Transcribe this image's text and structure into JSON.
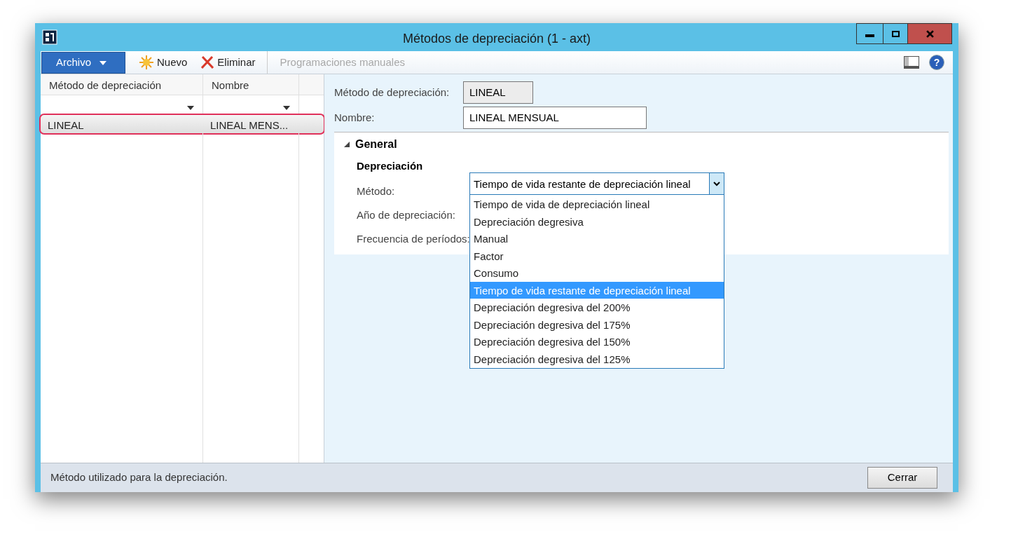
{
  "window": {
    "title": "Métodos de depreciación (1 - axt)"
  },
  "toolbar": {
    "file_menu": "Archivo",
    "buttons": [
      {
        "kind": "new",
        "label": "Nuevo",
        "disabled": false
      },
      {
        "kind": "delete",
        "label": "Eliminar",
        "disabled": false
      },
      {
        "kind": "plain",
        "label": "Programaciones manuales",
        "disabled": true
      }
    ]
  },
  "grid": {
    "columns": [
      "Método de depreciación",
      "Nombre"
    ],
    "rows": [
      {
        "cells": [
          "LINEAL",
          "LINEAL MENS..."
        ],
        "selected": true,
        "highlighted": true
      }
    ]
  },
  "header_fields": [
    {
      "label": "Método de depreciación:",
      "value": "LINEAL",
      "disabled": true
    },
    {
      "label": "Nombre:",
      "value": "LINEAL MENSUAL",
      "disabled": false
    }
  ],
  "section": {
    "title": "General",
    "expanded": true,
    "group": "Depreciación",
    "fields": [
      {
        "label": "Método:"
      },
      {
        "label": "Año de depreciación:"
      },
      {
        "label": "Frecuencia de períodos:"
      }
    ]
  },
  "method_dropdown": {
    "value": "Tiempo de vida restante de depreciación lineal",
    "expanded": true,
    "options": [
      {
        "label": "Tiempo de vida de depreciación lineal",
        "selected": false
      },
      {
        "label": "Depreciación degresiva",
        "selected": false
      },
      {
        "label": "Manual",
        "selected": false
      },
      {
        "label": "Factor",
        "selected": false
      },
      {
        "label": "Consumo",
        "selected": false
      },
      {
        "label": "Tiempo de vida restante de depreciación lineal",
        "selected": true
      },
      {
        "label": "Depreciación degresiva del 200%",
        "selected": false
      },
      {
        "label": "Depreciación degresiva del 175%",
        "selected": false
      },
      {
        "label": "Depreciación degresiva del 150%",
        "selected": false
      },
      {
        "label": "Depreciación degresiva del 125%",
        "selected": false
      }
    ]
  },
  "help_button": "?",
  "status_bar": {
    "text": "Método utilizado para la depreciación.",
    "close_button": "Cerrar"
  }
}
